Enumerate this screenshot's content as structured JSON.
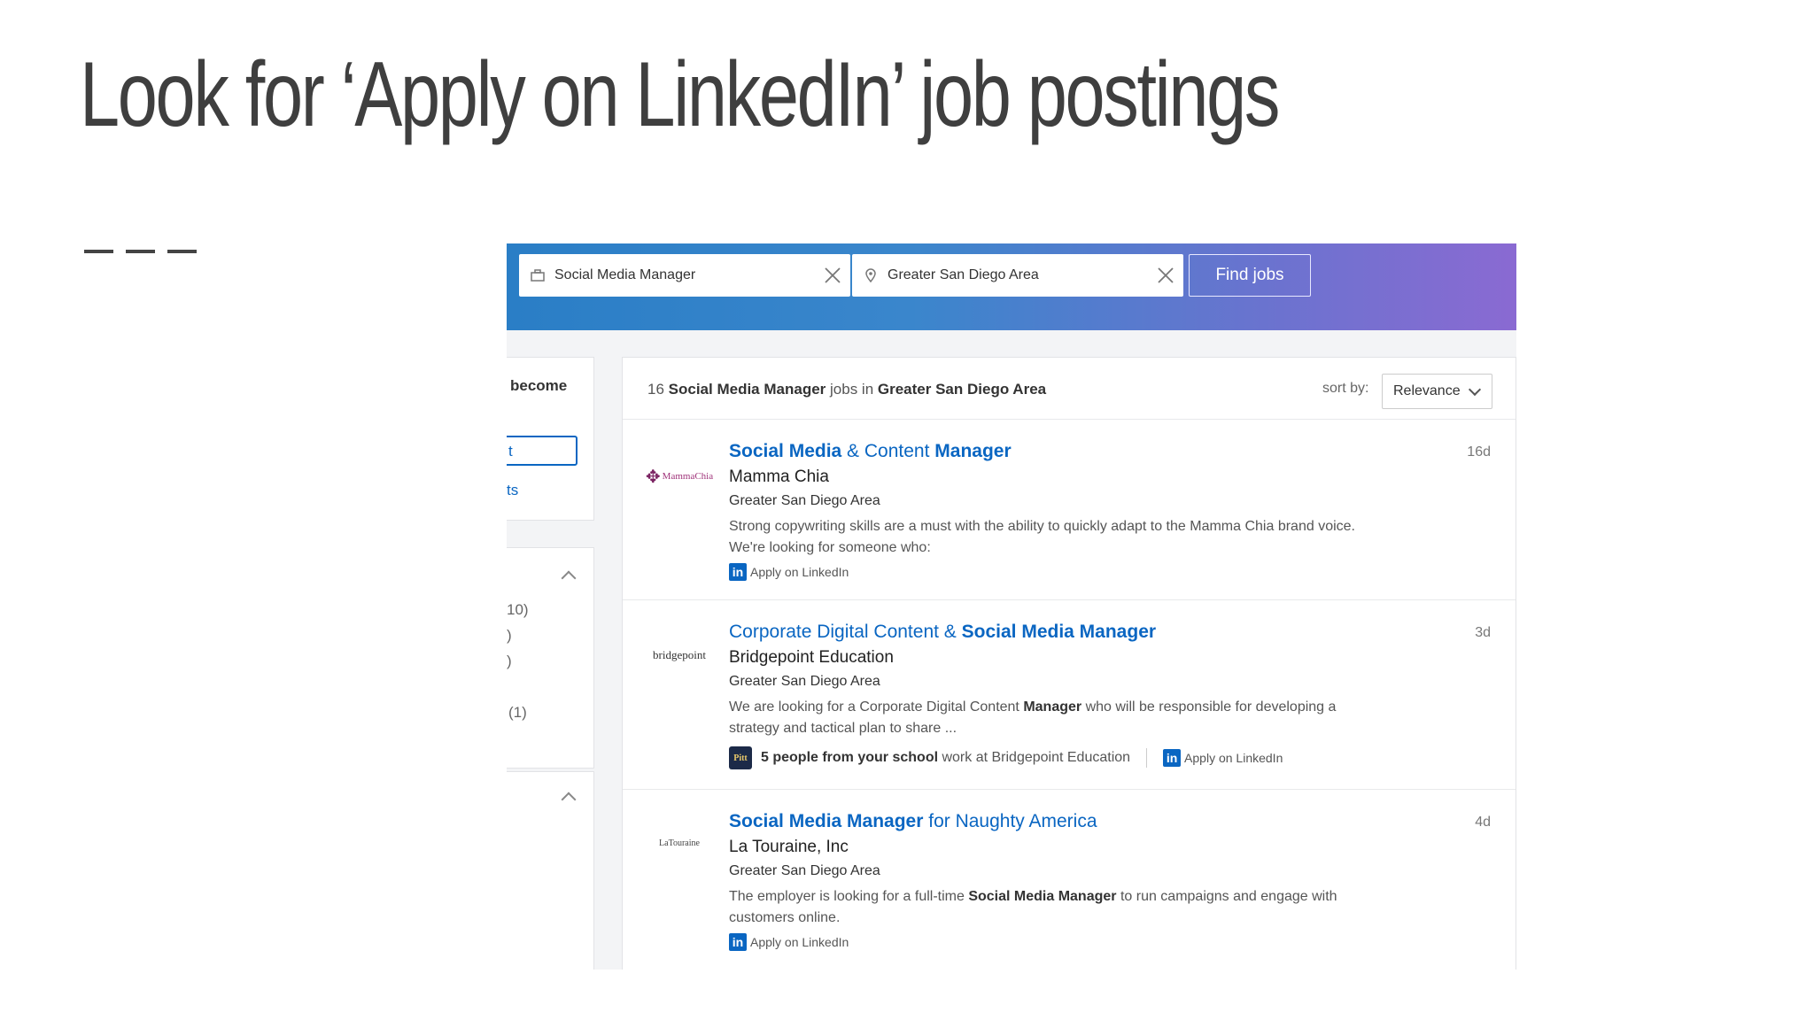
{
  "slide": {
    "title": "Look for ‘Apply on LinkedIn’ job postings"
  },
  "search": {
    "keyword_value": "Social Media Manager",
    "location_value": "Greater San Diego Area",
    "find_label": "Find jobs"
  },
  "sidebar": {
    "partial_text_1": "become",
    "partial_input_text": "t",
    "partial_link": "ts",
    "facet_counts": [
      "10)",
      ")",
      ")",
      "(1)"
    ]
  },
  "results": {
    "count": "16",
    "keyword": "Social Media Manager",
    "jobs_in": "jobs in",
    "location": "Greater San Diego Area",
    "sort_label": "sort by:",
    "sort_value": "Relevance"
  },
  "jobs": [
    {
      "title_parts": [
        "Social Media",
        " & Content ",
        "Manager"
      ],
      "company": "Mamma Chia",
      "location": "Greater San Diego Area",
      "description": "Strong copywriting skills are a must with the ability to quickly adapt to the Mamma Chia brand voice. We're looking for someone who:",
      "age": "16d",
      "apply": "Apply on LinkedIn",
      "logo_text": "MammaChia"
    },
    {
      "title_parts": [
        "Corporate Digital Content & ",
        "Social Media Manager"
      ],
      "company": "Bridgepoint Education",
      "location": "Greater San Diego Area",
      "description_parts": [
        "We are looking for a Corporate Digital Content ",
        "Manager",
        " who will be responsible for developing a strategy and tactical plan to share ..."
      ],
      "age": "3d",
      "alumni_bold": "5 people from your school",
      "alumni_rest": " work at Bridgepoint Education",
      "apply": "Apply on LinkedIn",
      "logo_text": "bridgepoint"
    },
    {
      "title_parts": [
        "Social Media Manager",
        " for Naughty America"
      ],
      "company": "La Touraine, Inc",
      "location": "Greater San Diego Area",
      "description_parts": [
        "The employer is looking for a full-time ",
        "Social Media Manager",
        " to run campaigns and engage with customers online."
      ],
      "age": "4d",
      "apply": "Apply on LinkedIn",
      "logo_text": "LaTouraine"
    }
  ],
  "colors": {
    "link_blue": "#0a66c2",
    "header_start": "#2a7ec6",
    "header_end": "#8a6ad2"
  }
}
